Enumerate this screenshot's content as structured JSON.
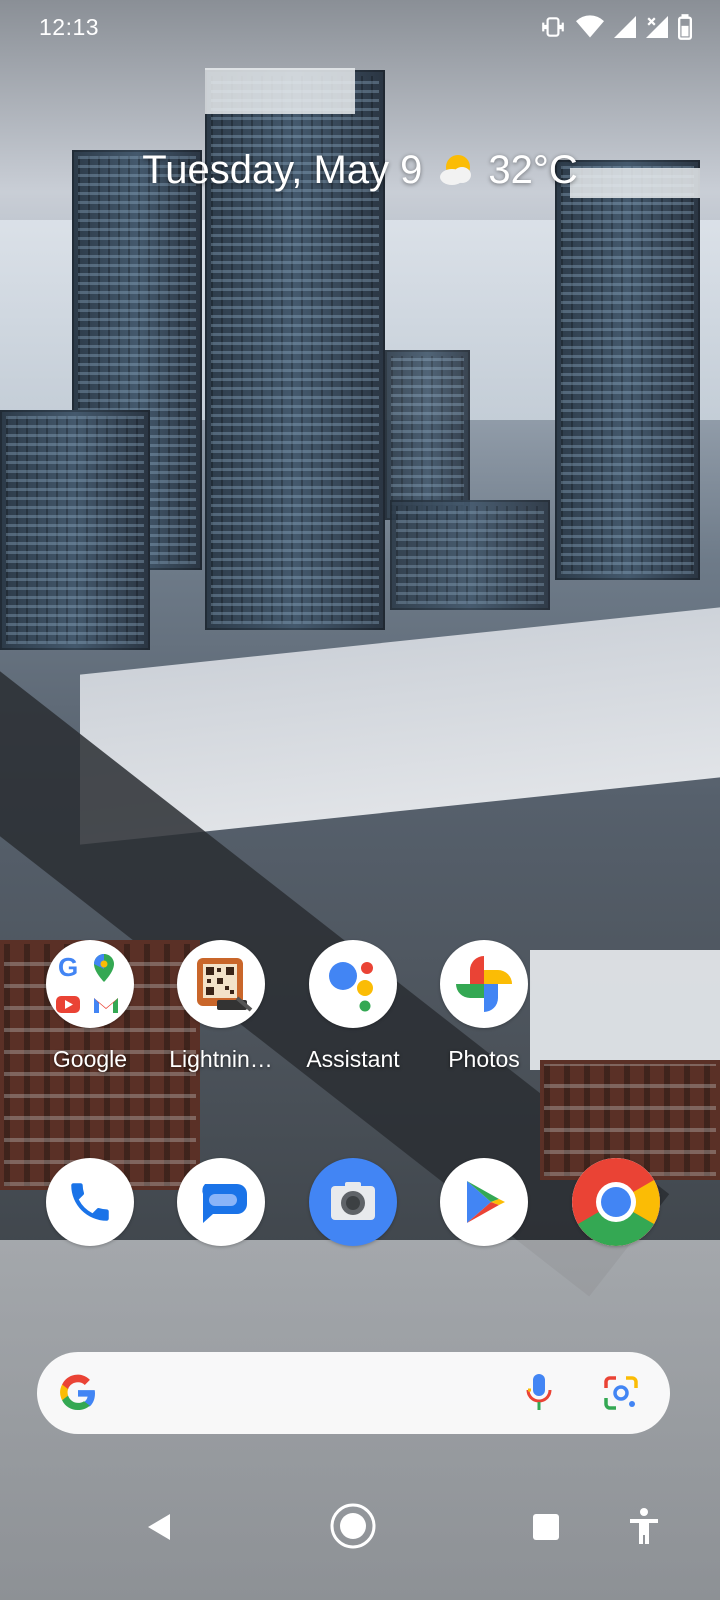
{
  "status_bar": {
    "time": "12:13",
    "icons": [
      "vibrate-icon",
      "wifi-icon",
      "signal-icon",
      "signal-no-data-icon",
      "battery-icon"
    ]
  },
  "at_a_glance": {
    "date": "Tuesday, May 9",
    "weather_icon": "partly-cloudy-icon",
    "temperature": "32°C"
  },
  "home_row": [
    {
      "label": "Google",
      "icon": "google-folder-icon"
    },
    {
      "label": "Lightnin…",
      "icon": "lightning-qr-icon"
    },
    {
      "label": "Assistant",
      "icon": "assistant-icon"
    },
    {
      "label": "Photos",
      "icon": "photos-icon"
    }
  ],
  "dock": [
    {
      "icon": "phone-icon"
    },
    {
      "icon": "messages-icon"
    },
    {
      "icon": "camera-icon"
    },
    {
      "icon": "play-store-icon"
    },
    {
      "icon": "chrome-icon"
    }
  ],
  "search_bar": {
    "icons": [
      "google-g-icon",
      "microphone-icon",
      "google-lens-icon"
    ]
  },
  "nav_bar": {
    "buttons": [
      "back-icon",
      "home-icon",
      "recents-icon",
      "accessibility-icon"
    ]
  },
  "colors": {
    "google_blue": "#4285F4",
    "google_red": "#EA4335",
    "google_yellow": "#FBBC05",
    "google_green": "#34A853"
  }
}
